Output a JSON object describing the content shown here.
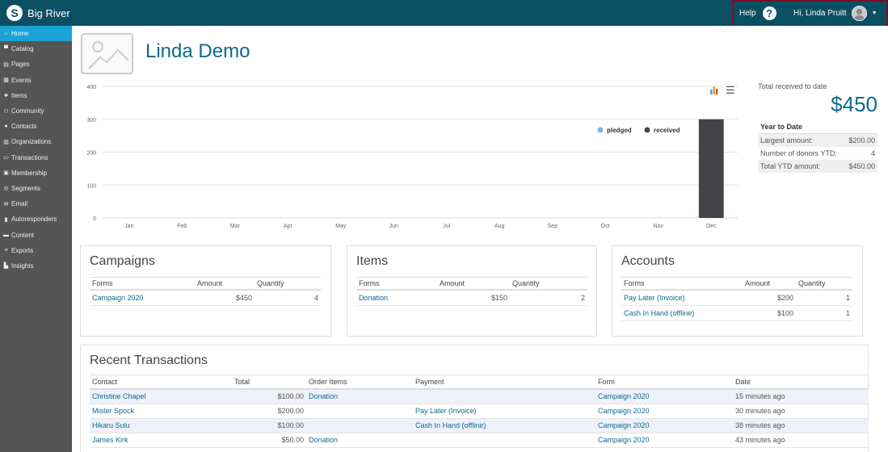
{
  "app": {
    "name": "Big River"
  },
  "header": {
    "help_label": "Help",
    "greeting": "Hi, Linda Pruitt"
  },
  "sidebar": {
    "items": [
      {
        "label": "Home",
        "icon": "home-icon",
        "glyph": "⌂",
        "active": true
      },
      {
        "label": "Catalog",
        "icon": "cart-icon",
        "glyph": "▀"
      },
      {
        "label": "Pages",
        "icon": "pages-icon",
        "glyph": "▤"
      },
      {
        "label": "Events",
        "icon": "calendar-icon",
        "glyph": "▦"
      },
      {
        "label": "Items",
        "icon": "items-icon",
        "glyph": "♣"
      },
      {
        "label": "Community",
        "icon": "users-icon",
        "glyph": "⚇"
      },
      {
        "label": "Contacts",
        "icon": "user-icon",
        "glyph": "●"
      },
      {
        "label": "Organizations",
        "icon": "building-icon",
        "glyph": "▥"
      },
      {
        "label": "Transactions",
        "icon": "money-icon",
        "glyph": "▭"
      },
      {
        "label": "Membership",
        "icon": "id-card-icon",
        "glyph": "▣"
      },
      {
        "label": "Segments",
        "icon": "segments-icon",
        "glyph": "◎"
      },
      {
        "label": "Email",
        "icon": "envelope-icon",
        "glyph": "✉"
      },
      {
        "label": "Autoresponders",
        "icon": "autoresponder-icon",
        "glyph": "▮"
      },
      {
        "label": "Content",
        "icon": "folder-icon",
        "glyph": "▬"
      },
      {
        "label": "Exports",
        "icon": "database-icon",
        "glyph": "≡"
      },
      {
        "label": "Insights",
        "icon": "chart-icon",
        "glyph": "▙"
      }
    ]
  },
  "page": {
    "title": "Linda Demo"
  },
  "chart_data": {
    "type": "bar",
    "categories": [
      "Jan",
      "Feb",
      "Mar",
      "Apr",
      "May",
      "Jun",
      "Jul",
      "Aug",
      "Sep",
      "Oct",
      "Nov",
      "Dec"
    ],
    "series": [
      {
        "name": "pledged",
        "color": "#7cb5ec",
        "values": [
          0,
          0,
          0,
          0,
          0,
          0,
          0,
          0,
          0,
          0,
          0,
          0
        ]
      },
      {
        "name": "received",
        "color": "#434348",
        "values": [
          0,
          0,
          0,
          0,
          0,
          0,
          0,
          0,
          0,
          0,
          0,
          300
        ]
      }
    ],
    "yticks": [
      "0",
      "100",
      "200",
      "300",
      "400"
    ],
    "ylim": [
      0,
      400
    ],
    "grid": true,
    "legend": "top-right"
  },
  "ytd": {
    "label": "Total received to date",
    "total": "$450",
    "section_label": "Year to Date",
    "rows": [
      {
        "label": "Largest amount:",
        "value": "$200.00"
      },
      {
        "label": "Number of donors YTD:",
        "value": "4"
      },
      {
        "label": "Total YTD amount:",
        "value": "$450.00"
      }
    ]
  },
  "campaigns": {
    "title": "Campaigns",
    "headers": [
      "Forms",
      "Amount",
      "Quantity"
    ],
    "rows": [
      {
        "form": "Campaign 2020",
        "amount": "$450",
        "quantity": "4"
      }
    ]
  },
  "items": {
    "title": "Items",
    "headers": [
      "Forms",
      "Amount",
      "Quantity"
    ],
    "rows": [
      {
        "form": "Donation",
        "amount": "$150",
        "quantity": "2"
      }
    ]
  },
  "accounts": {
    "title": "Accounts",
    "headers": [
      "Forms",
      "Amount",
      "Quantity"
    ],
    "rows": [
      {
        "form": "Pay Later (Invoice)",
        "amount": "$200",
        "quantity": "1"
      },
      {
        "form": "Cash In Hand (offline)",
        "amount": "$100",
        "quantity": "1"
      }
    ]
  },
  "recent": {
    "title": "Recent Transactions",
    "headers": [
      "Contact",
      "Total",
      "Order Items",
      "Payment",
      "Form",
      "Date"
    ],
    "rows": [
      {
        "contact": "Christine Chapel",
        "total": "$100.00",
        "order_items": "Donation",
        "payment": "",
        "form": "Campaign 2020",
        "date": "15 minutes ago"
      },
      {
        "contact": "Mister Spock",
        "total": "$200.00",
        "order_items": "",
        "payment": "Pay Later (Invoice)",
        "form": "Campaign 2020",
        "date": "30 minutes ago"
      },
      {
        "contact": "Hikaru Sulu",
        "total": "$100.00",
        "order_items": "",
        "payment": "Cash In Hand (offline)",
        "form": "Campaign 2020",
        "date": "38 minutes ago"
      },
      {
        "contact": "James Kirk",
        "total": "$50.00",
        "order_items": "Donation",
        "payment": "",
        "form": "Campaign 2020",
        "date": "43 minutes ago"
      }
    ]
  }
}
